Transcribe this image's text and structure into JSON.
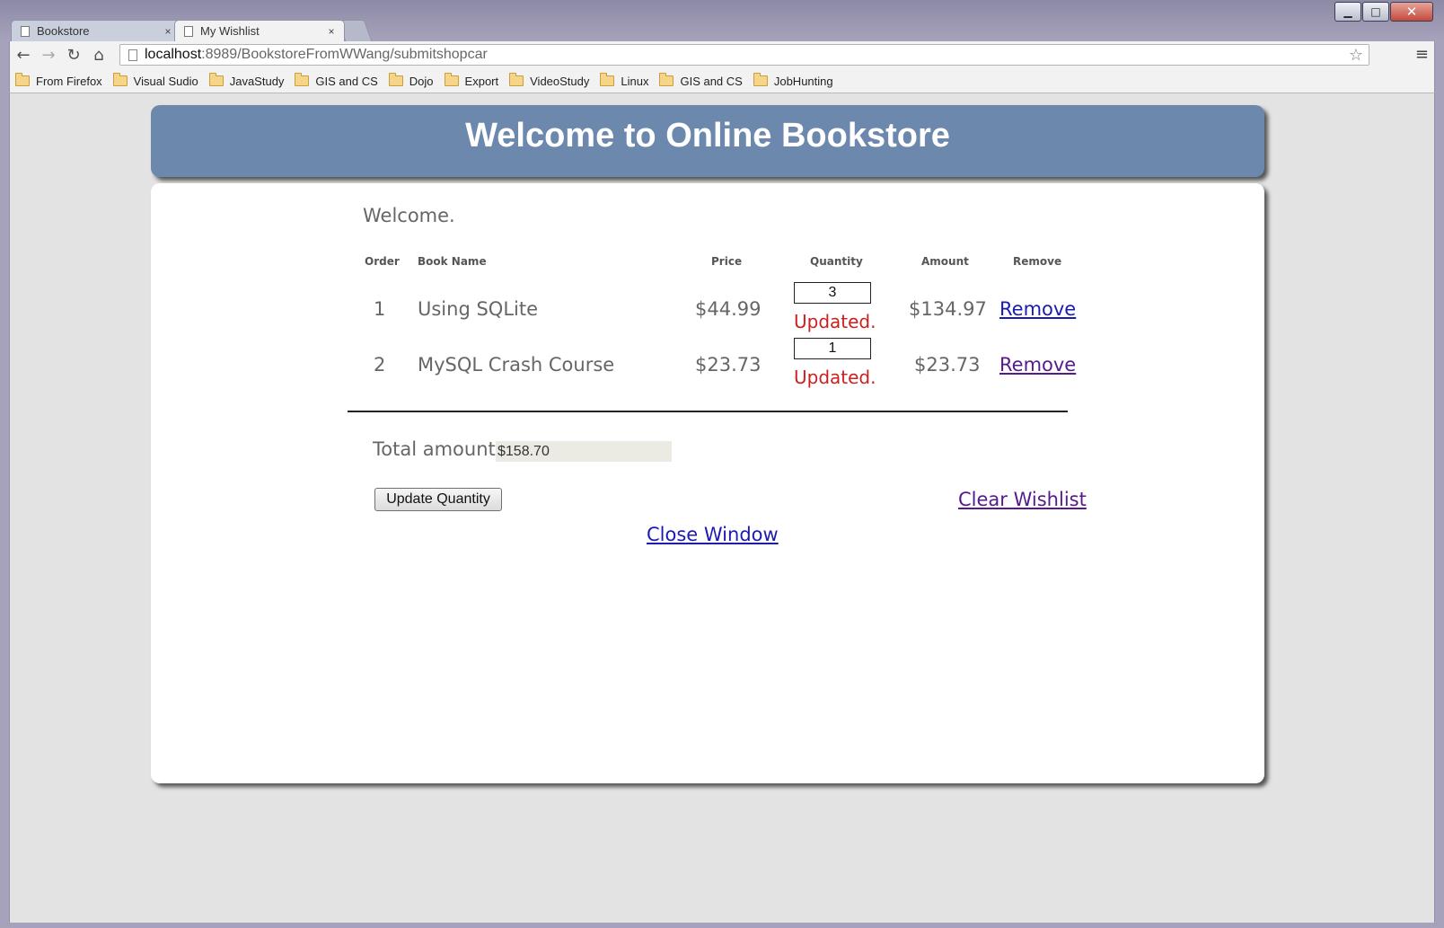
{
  "window": {
    "controls": {
      "minimize": "▁",
      "maximize": "□",
      "close": "✕"
    }
  },
  "tabs": [
    {
      "label": "Bookstore",
      "close": "×",
      "active": false
    },
    {
      "label": "My Wishlist",
      "close": "×",
      "active": true
    }
  ],
  "toolbar": {
    "back": "←",
    "forward": "→",
    "reload": "↻",
    "home": "⌂",
    "url_host": "localhost",
    "url_rest": ":8989/BookstoreFromWWang/submitshopcar",
    "star": "☆",
    "menu": "≡"
  },
  "bookmarks": [
    "From Firefox",
    "Visual Sudio",
    "JavaStudy",
    "GIS and CS",
    "Dojo",
    "Export",
    "VideoStudy",
    "Linux",
    "GIS and CS",
    "JobHunting"
  ],
  "page": {
    "header_title": "Welcome to Online Bookstore",
    "welcome": "Welcome.",
    "columns": {
      "order": "Order",
      "book_name": "Book Name",
      "price": "Price",
      "quantity": "Quantity",
      "amount": "Amount",
      "remove": "Remove"
    },
    "rows": [
      {
        "order": "1",
        "book_name": "Using SQLite",
        "price": "$44.99",
        "quantity": "3",
        "status": "Updated.",
        "amount": "$134.97",
        "remove": "Remove"
      },
      {
        "order": "2",
        "book_name": "MySQL Crash Course",
        "price": "$23.73",
        "quantity": "1",
        "status": "Updated.",
        "amount": "$23.73",
        "remove": "Remove"
      }
    ],
    "total_label": "Total amount:",
    "total_value": "$158.70",
    "update_button": "Update Quantity",
    "clear_link": "Clear Wishlist",
    "close_link": "Close Window"
  },
  "colors": {
    "header_bg": "#6d88ad",
    "updated_text": "#cc1f1f",
    "link": "#1b1bb0",
    "visited_link": "#551a8b"
  }
}
